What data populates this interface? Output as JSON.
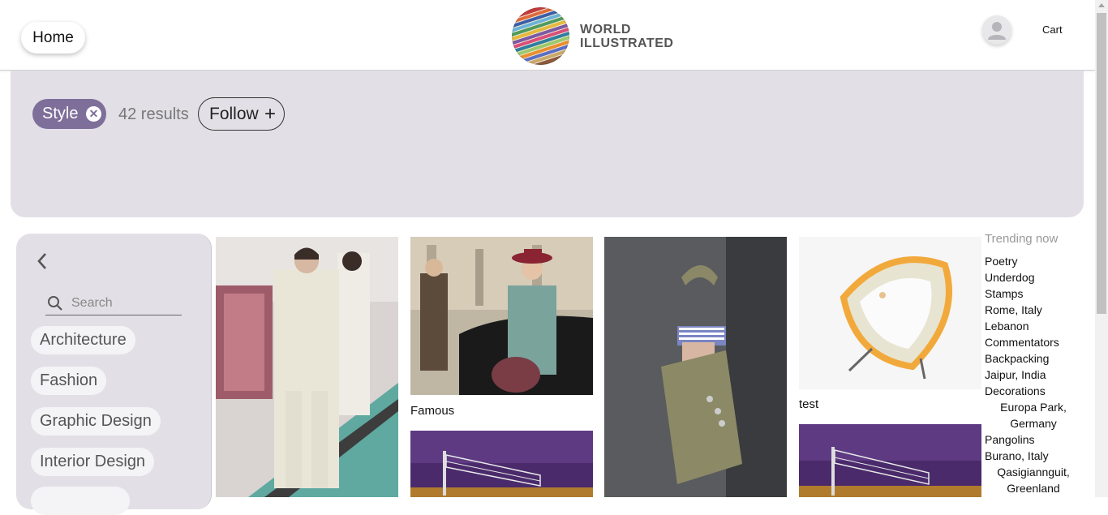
{
  "header": {
    "home_label": "Home",
    "logo_line1": "WORLD",
    "logo_line2": "ILLUSTRATED",
    "cart_label": "Cart"
  },
  "filter": {
    "active_tag": "Style",
    "results_text": "42 results",
    "follow_label": "Follow",
    "follow_icon": "+",
    "remove_icon": "✕"
  },
  "sidebar": {
    "search_placeholder": "Search",
    "categories": [
      {
        "label": "Architecture"
      },
      {
        "label": "Fashion"
      },
      {
        "label": "Graphic Design"
      },
      {
        "label": "Interior Design"
      }
    ]
  },
  "grid": {
    "captions": [
      "Famous",
      "test"
    ]
  },
  "trending": {
    "title": "Trending now",
    "items": [
      "Poetry",
      "Underdog",
      "Stamps",
      "Rome, Italy",
      "Lebanon",
      "Commentators",
      "Backpacking",
      "Jaipur, India",
      "Decorations",
      "Europa Park,",
      "Germany",
      "Pangolins",
      "Burano, Italy",
      "Qasigiannguit,",
      "Greenland"
    ]
  }
}
